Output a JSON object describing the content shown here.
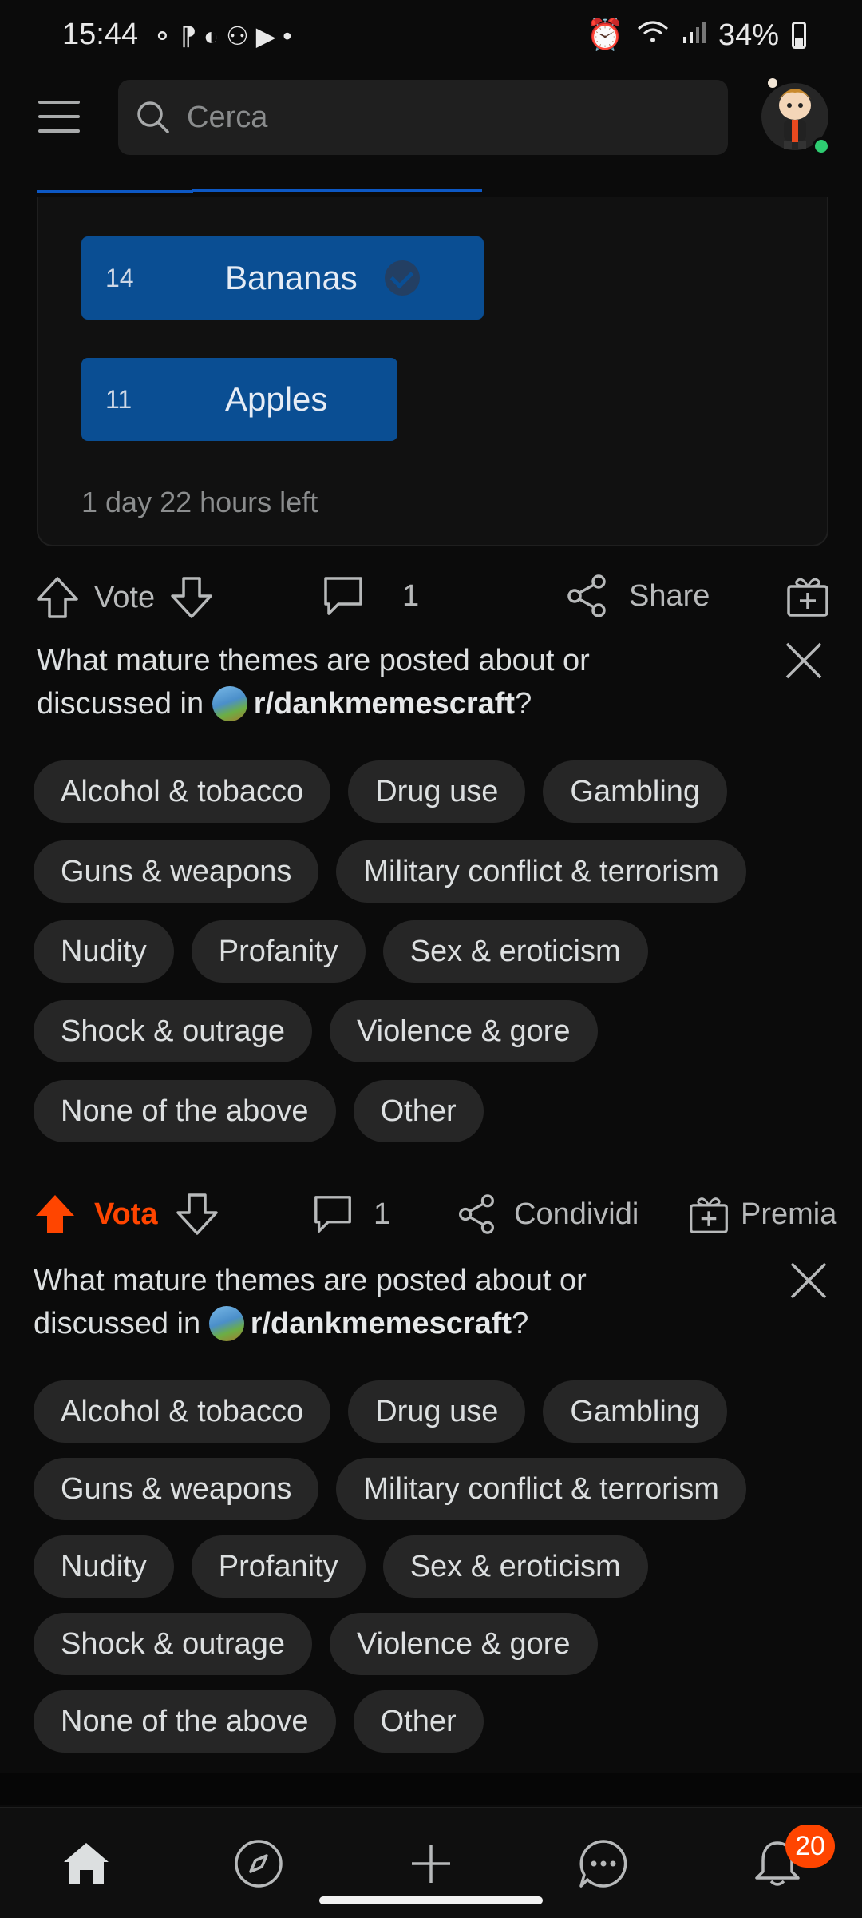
{
  "status_bar": {
    "time": "15:44",
    "battery": "34%",
    "notification_glyphs": "⚬ ⁋ ◐ ⚇ ▶ •"
  },
  "search": {
    "placeholder": "Cerca"
  },
  "poll": {
    "options": [
      {
        "label": "Bananas",
        "votes": "14",
        "selected": true
      },
      {
        "label": "Apples",
        "votes": "11",
        "selected": false
      }
    ],
    "time_left": "1 day 22 hours left"
  },
  "actions_en": {
    "vote": "Vote",
    "comments": "1",
    "share": "Share"
  },
  "prompt_en": {
    "line1": "What mature themes are posted about or",
    "line2_prefix": "discussed in",
    "subreddit": "r/dankmemescraft",
    "suffix": "?"
  },
  "chips_en": [
    [
      "Alcohol & tobacco",
      "Drug use",
      "Gambling"
    ],
    [
      "Guns & weapons",
      "Military conflict & terrorism"
    ],
    [
      "Nudity",
      "Profanity",
      "Sex & eroticism"
    ],
    [
      "Shock & outrage",
      "Violence & gore"
    ],
    [
      "None of the above",
      "Other"
    ]
  ],
  "actions_it": {
    "vote": "Vota",
    "comments": "1",
    "share": "Condividi",
    "award": "Premia"
  },
  "prompt_it": {
    "line1": "What mature themes are posted about or",
    "line2_prefix": "discussed in",
    "subreddit": "r/dankmemescraft",
    "suffix": "?"
  },
  "chips_it": [
    [
      "Alcohol & tobacco",
      "Drug use",
      "Gambling"
    ],
    [
      "Guns & weapons",
      "Military conflict & terrorism"
    ],
    [
      "Nudity",
      "Profanity",
      "Sex & eroticism"
    ],
    [
      "Shock & outrage",
      "Violence & gore"
    ],
    [
      "None of the above",
      "Other"
    ]
  ],
  "nav": {
    "notifications_badge": "20"
  },
  "colors": {
    "accent": "#ff4500",
    "poll_bar": "#0a4e93",
    "online": "#2ecc71"
  }
}
